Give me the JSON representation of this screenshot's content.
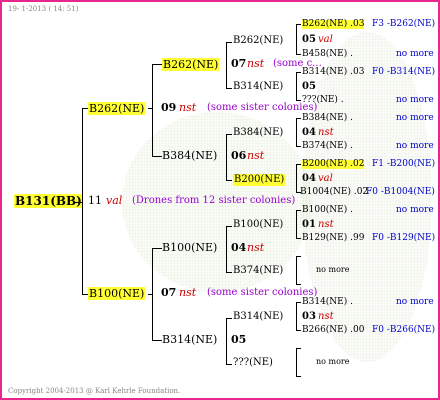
{
  "header": {
    "date": "19-  1-2013  ( 14: 51)"
  },
  "footer": {
    "copyright": "Copyright 2004-2013 @ Karl Kehrle Foundation."
  },
  "root": {
    "id": "B131(BB)"
  },
  "center": {
    "num": "11",
    "code": "val",
    "note": "(Drones from 12 sister colonies)"
  },
  "gen1": [
    {
      "id": "B262(NE)",
      "num": "09",
      "code": "nst",
      "note": "(some sister colonies)"
    },
    {
      "id": "B100(NE)",
      "num": "07",
      "code": "nst",
      "note": "(some sister colonies)"
    }
  ],
  "gen2": [
    {
      "id": "B262(NE)",
      "num": "07",
      "code": "nst",
      "note": "(some c..."
    },
    {
      "id": "B384(NE)",
      "num": "06",
      "code": "nst"
    },
    {
      "id": "B100(NE)",
      "num": "04",
      "code": "nst"
    },
    {
      "id": "B314(NE)",
      "num": "05"
    }
  ],
  "gen3": [
    {
      "id": "B262(NE)"
    },
    {
      "id": "B314(NE)"
    },
    {
      "id": "B384(NE)"
    },
    {
      "id": "B200(NE)"
    },
    {
      "id": "B100(NE)"
    },
    {
      "id": "B374(NE)"
    },
    {
      "id": "B314(NE)"
    },
    {
      "id": "???(NE)"
    }
  ],
  "gen4": [
    {
      "id": "B262(NE) .03",
      "ref": "F3 -B262(NE)",
      "num": "05",
      "code": "val",
      "sub": "B458(NE) .",
      "subref": "no more"
    },
    {
      "id": "B314(NE) .03",
      "ref": "F0 -B314(NE)",
      "num": "05",
      "code": "",
      "sub": "???(NE) .",
      "subref": "no more"
    },
    {
      "id": "B384(NE) .",
      "ref": "no more",
      "num": "04",
      "code": "nst",
      "sub": "B374(NE) .",
      "subref": "no more"
    },
    {
      "id": "B200(NE) .02",
      "ref": "F1 -B200(NE)",
      "num": "04",
      "code": "val",
      "sub": "B1004(NE) .02",
      "subref": "F0 -B1004(NE)"
    },
    {
      "id": "B100(NE) .",
      "ref": "no more",
      "num": "01",
      "code": "nst",
      "sub": "B129(NE) .99",
      "subref": "F0 -B129(NE)"
    },
    {
      "id": "",
      "ref": "no more"
    },
    {
      "id": "B314(NE) .",
      "ref": "no more",
      "num": "03",
      "code": "nst",
      "sub": "B266(NE) .00",
      "subref": "F0 -B266(NE)"
    },
    {
      "id": "",
      "ref": "no more"
    }
  ],
  "colors": {
    "border": "#e8278e",
    "highlight": "#ffff33",
    "code": "#cc0000",
    "note": "#9900cc",
    "ref": "#0000cc"
  }
}
